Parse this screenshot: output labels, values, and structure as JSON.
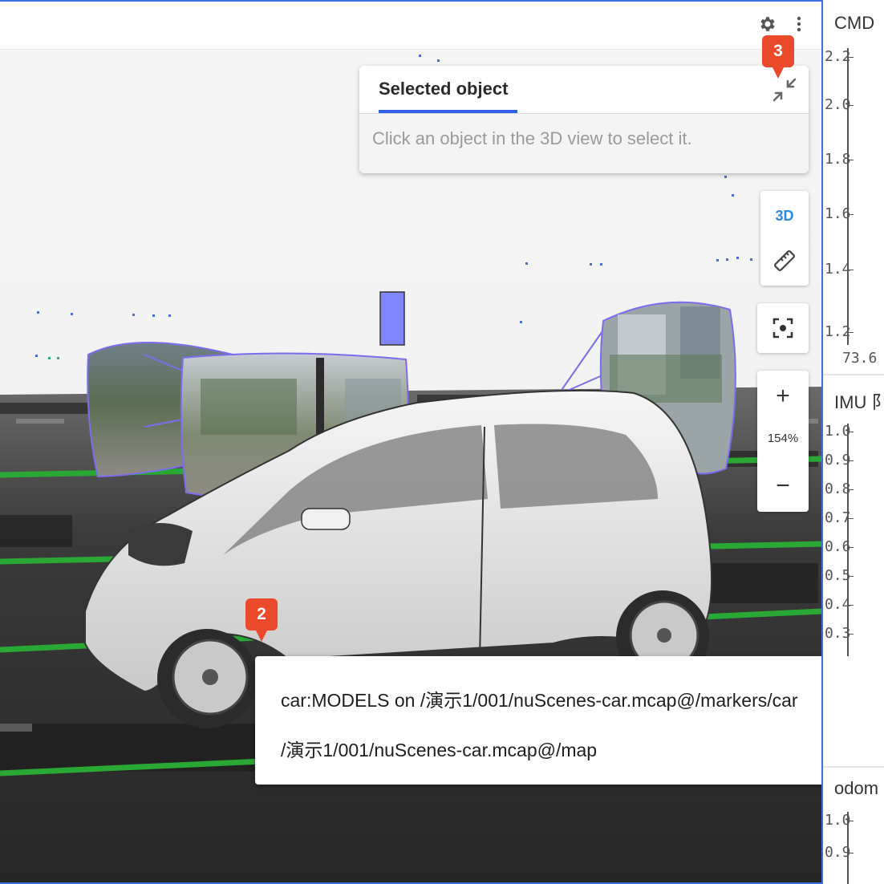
{
  "toolbar": {
    "settings_icon": "gear-icon",
    "menu_icon": "kebab-menu-icon"
  },
  "selected_object": {
    "tab_label": "Selected object",
    "hint": "Click an object in the 3D view to select it.",
    "collapse_icon": "collapse-arrows-icon"
  },
  "tools": {
    "view_mode_label": "3D",
    "measure_icon": "ruler-icon",
    "focus_icon": "focus-target-icon",
    "zoom_in_label": "+",
    "zoom_level": "154%",
    "zoom_out_label": "−"
  },
  "tooltip": {
    "line1": "car:MODELS on /演示1/001/nuScenes-car.mcap@/markers/car",
    "line2": "/演示1/001/nuScenes-car.mcap@/map"
  },
  "badges": {
    "tooltip_badge": "2",
    "collapse_badge": "3"
  },
  "plots": {
    "cmd": {
      "title": "CMD",
      "ticks": [
        "2.2",
        "2.0",
        "1.8",
        "1.6",
        "1.4",
        "1.2"
      ],
      "x_tick": "73.6"
    },
    "imu": {
      "title": "IMU 阝",
      "ticks": [
        "1.0",
        "0.9",
        "0.8",
        "0.7",
        "0.6",
        "0.5",
        "0.4",
        "0.3"
      ]
    },
    "odom": {
      "title": "odom",
      "ticks": [
        "1.0",
        "0.9"
      ]
    }
  },
  "colors": {
    "accent": "#2d62e8",
    "badge": "#ea4a2a",
    "frustum": "#7b6cf0",
    "grid_lines": "#2aa834"
  }
}
